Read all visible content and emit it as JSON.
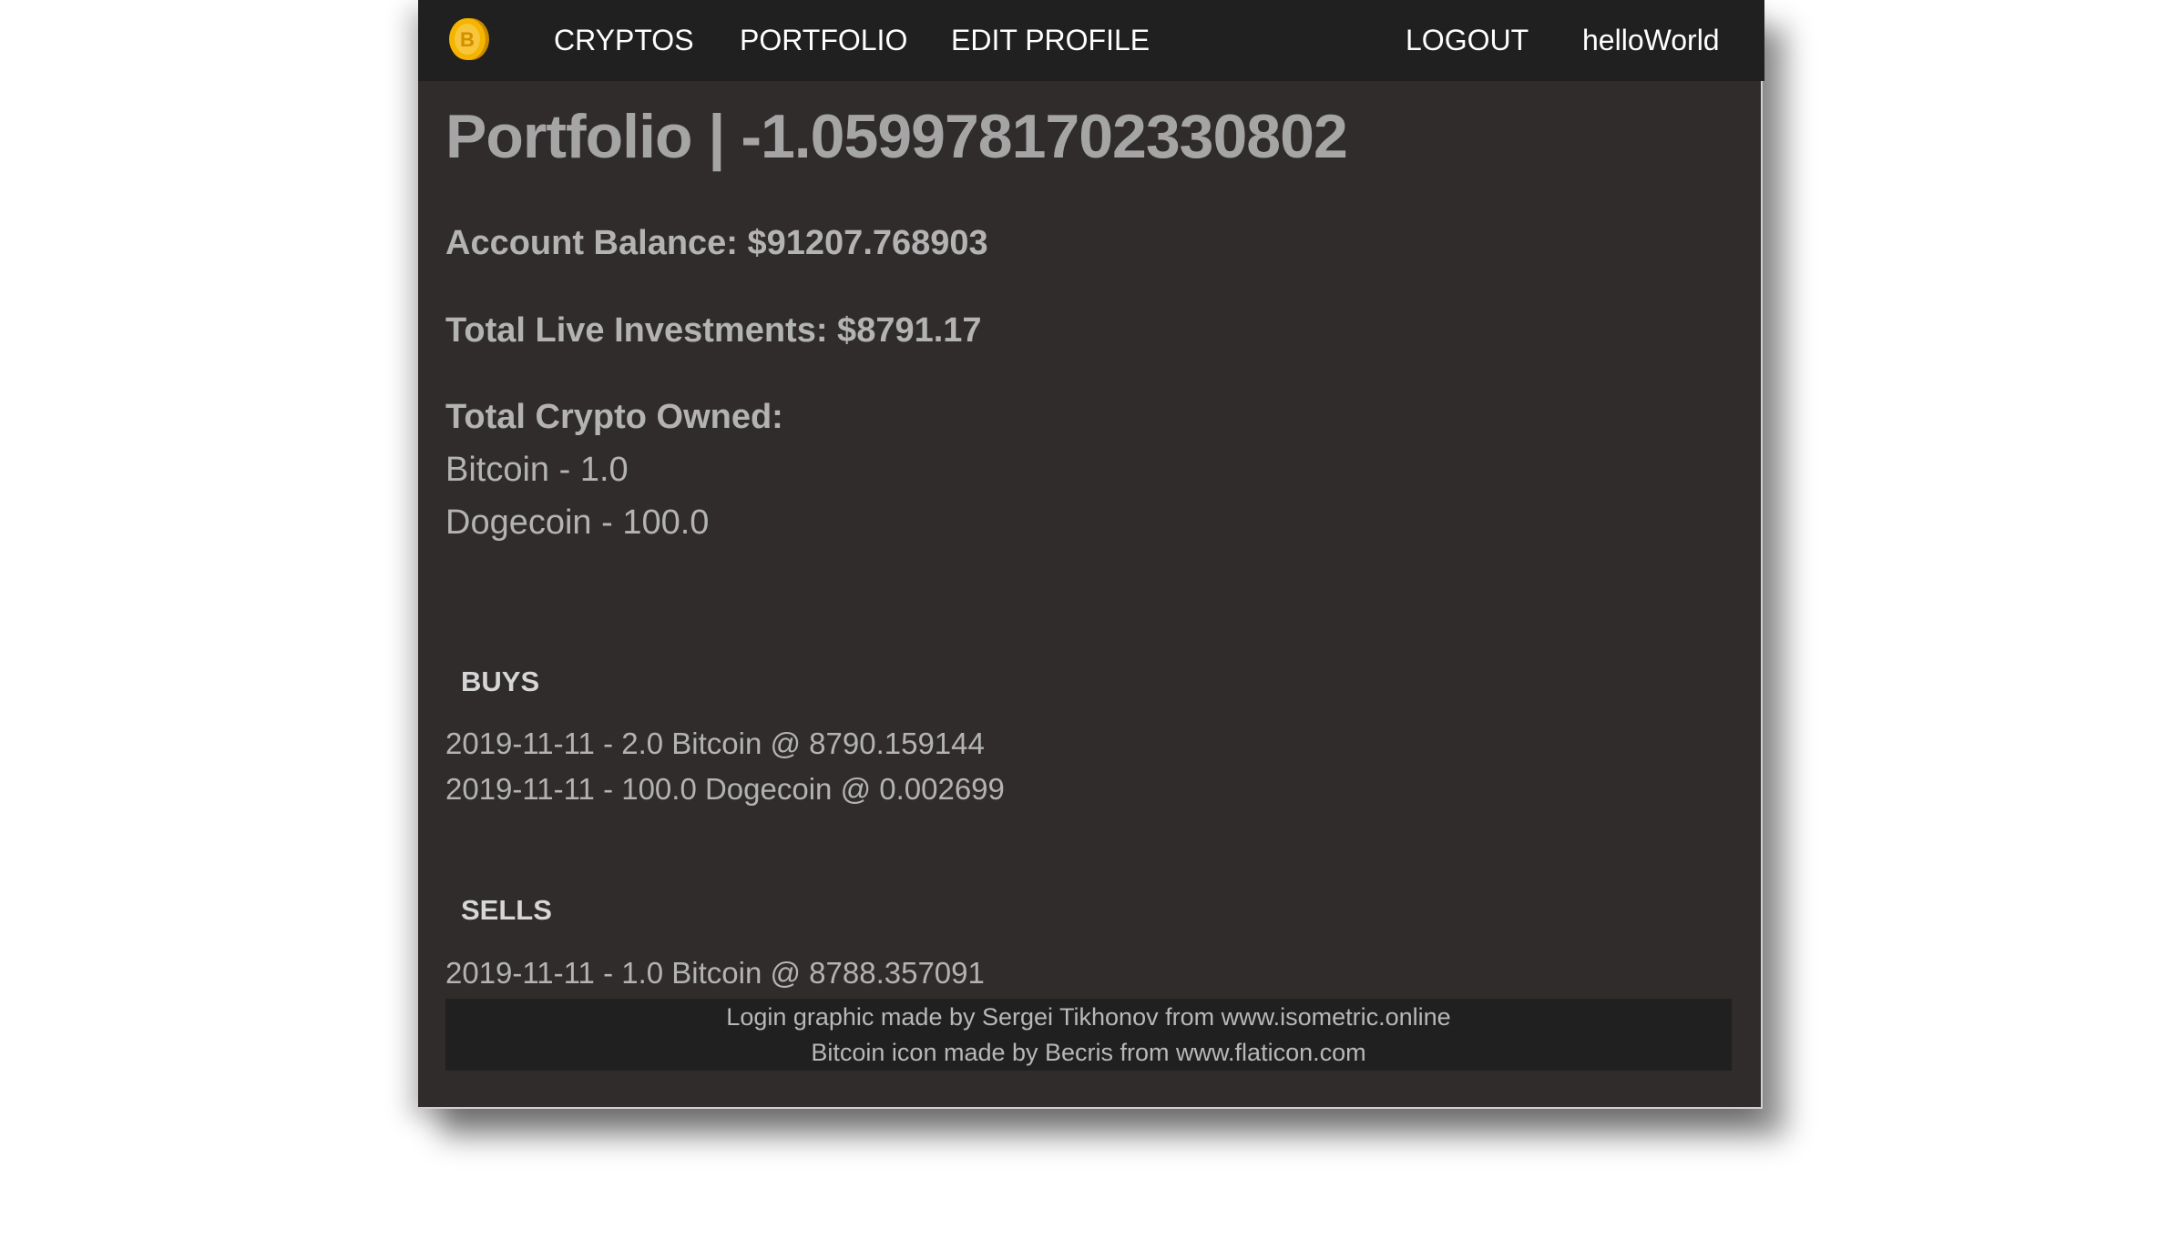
{
  "nav": {
    "logo_icon": "bitcoin-coin-icon",
    "links": {
      "cryptos": "CRYPTOS",
      "portfolio": "PORTFOLIO",
      "edit_profile": "EDIT PROFILE",
      "logout": "LOGOUT",
      "username": "helloWorld"
    }
  },
  "portfolio": {
    "title": "Portfolio | -1.0599781702330802",
    "account_balance": "Account Balance: $91207.768903",
    "total_live_investments": "Total Live Investments: $8791.17",
    "total_crypto_owned_label": "Total Crypto Owned:",
    "owned": [
      "Bitcoin - 1.0",
      "Dogecoin - 100.0"
    ]
  },
  "buys": {
    "heading": "BUYS",
    "items": [
      "2019-11-11 - 2.0 Bitcoin @ 8790.159144",
      "2019-11-11 - 100.0 Dogecoin @ 0.002699"
    ]
  },
  "sells": {
    "heading": "SELLS",
    "items": [
      "2019-11-11 - 1.0 Bitcoin @ 8788.357091"
    ]
  },
  "footer": {
    "line1": "Login graphic made by Sergei Tikhonov from www.isometric.online",
    "line2": "Bitcoin icon made by Becris from www.flaticon.com"
  },
  "colors": {
    "window_bg": "#302c2b",
    "navbar_bg": "#212020",
    "coin_gold": "#f5b400"
  }
}
